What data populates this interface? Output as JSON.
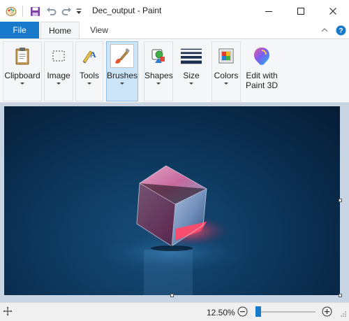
{
  "window": {
    "title": "Dec_output - Paint",
    "minimize_icon": "minimize-icon",
    "maximize_icon": "maximize-icon",
    "close_icon": "close-icon"
  },
  "quick_access": {
    "app_icon": "paint-palette-icon",
    "save_icon": "save-icon",
    "undo_icon": "undo-icon",
    "redo_icon": "redo-icon",
    "customize_icon": "chevron-down-icon"
  },
  "tabs": {
    "file": "File",
    "home": "Home",
    "view": "View",
    "active": "Home"
  },
  "ribbon": {
    "groups": [
      {
        "label": "Clipboard",
        "icon": "clipboard-icon",
        "has_dropdown": true
      },
      {
        "label": "Image",
        "icon": "select-icon",
        "has_dropdown": true
      },
      {
        "label": "Tools",
        "icon": "tools-icon",
        "has_dropdown": true
      },
      {
        "label": "Brushes",
        "icon": "brush-icon",
        "has_dropdown": true,
        "selected": true
      },
      {
        "label": "Shapes",
        "icon": "shapes-icon",
        "has_dropdown": true
      },
      {
        "label": "Size",
        "icon": "size-lines-icon",
        "has_dropdown": true
      },
      {
        "label": "Colors",
        "icon": "colors-icon",
        "has_dropdown": true
      },
      {
        "label": "Edit with",
        "label2": "Paint 3D",
        "icon": "paint3d-icon",
        "has_dropdown": false
      }
    ]
  },
  "statusbar": {
    "move_icon": "move-icon",
    "zoom": "12.50%",
    "zoom_level": 0.125,
    "zoom_out_icon": "zoom-out-icon",
    "zoom_in_icon": "zoom-in-icon"
  },
  "colors": {
    "accent": "#1979ca",
    "canvas_bg": "#c9d4e2",
    "selected_group_bg": "#cce4f7"
  }
}
